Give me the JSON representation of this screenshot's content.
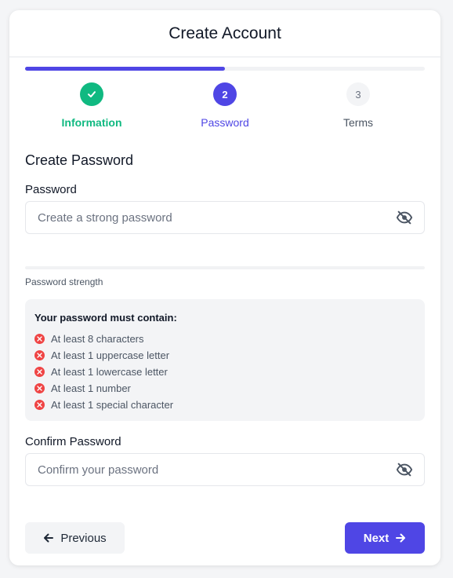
{
  "header": {
    "title": "Create Account"
  },
  "progress": {
    "fraction": 0.5
  },
  "steps": [
    {
      "number": "1",
      "label": "Information",
      "state": "complete"
    },
    {
      "number": "2",
      "label": "Password",
      "state": "active"
    },
    {
      "number": "3",
      "label": "Terms",
      "state": "pending"
    }
  ],
  "section": {
    "title": "Create Password"
  },
  "password": {
    "label": "Password",
    "placeholder": "Create a strong password",
    "value": "",
    "icon": "eye-off-icon"
  },
  "strength": {
    "label": "Password strength",
    "level": 0
  },
  "requirements": {
    "title": "Your password must contain:",
    "items": [
      "At least 8 characters",
      "At least 1 uppercase letter",
      "At least 1 lowercase letter",
      "At least 1 number",
      "At least 1 special character"
    ]
  },
  "confirm": {
    "label": "Confirm Password",
    "placeholder": "Confirm your password",
    "value": "",
    "icon": "eye-off-icon"
  },
  "buttons": {
    "previous": "Previous",
    "next": "Next"
  },
  "colors": {
    "accent": "#4f46e5",
    "success": "#10b981",
    "error": "#ef4444"
  }
}
